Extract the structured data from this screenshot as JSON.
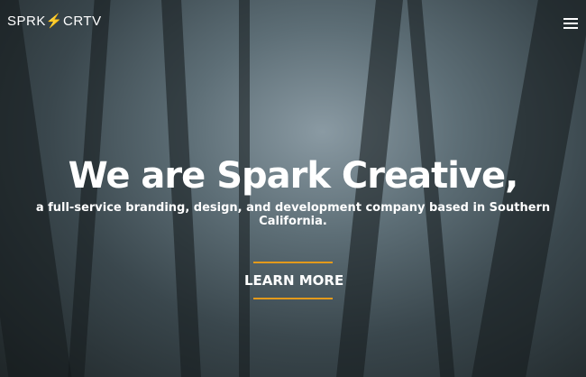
{
  "header": {
    "logo": "SPRK⚡CRTV",
    "menu_icon": "hamburger-icon"
  },
  "hero": {
    "title": "We are Spark Creative,",
    "subtitle": "a full-service branding, design, and development company based in Southern California.",
    "cta_label": "LEARN MORE"
  },
  "colors": {
    "accent": "#e39a1b"
  }
}
